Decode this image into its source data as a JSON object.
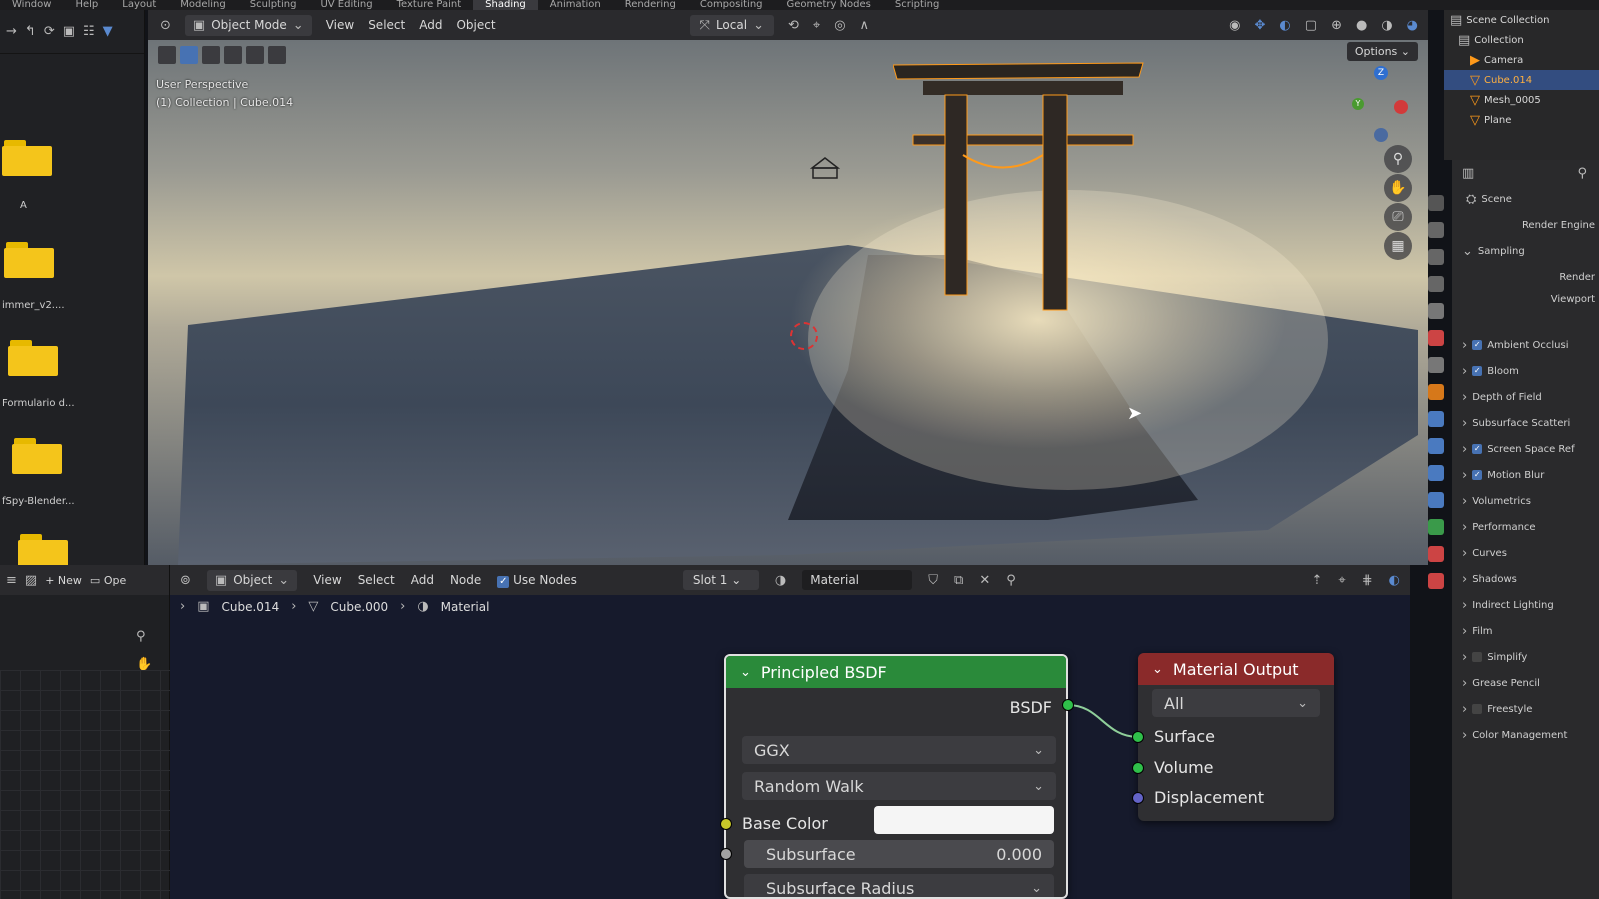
{
  "topbar": {
    "menus": [
      "Window",
      "Help"
    ],
    "workspaces": [
      "Layout",
      "Modeling",
      "Sculpting",
      "UV Editing",
      "Texture Paint",
      "Shading",
      "Animation",
      "Rendering",
      "Compositing",
      "Geometry Nodes",
      "Scripting"
    ],
    "active_workspace": "Shading"
  },
  "file_browser": {
    "items": [
      {
        "label": "A"
      },
      {
        "label": "immer_v2...."
      },
      {
        "label": "Formulario d..."
      },
      {
        "label": "fSpy-Blender..."
      },
      {
        "label": ""
      }
    ]
  },
  "viewport_header": {
    "mode": "Object Mode",
    "menus": [
      "View",
      "Select",
      "Add",
      "Object"
    ],
    "orientation": "Local"
  },
  "viewport": {
    "perspective_label": "User Perspective",
    "collection_label": "(1) Collection | Cube.014",
    "options_label": "Options",
    "gizmo_axes": {
      "z": "Z",
      "y": "Y"
    }
  },
  "node_header": {
    "object_selector": "Object",
    "menus": [
      "View",
      "Select",
      "Add",
      "Node"
    ],
    "use_nodes_label": "Use Nodes",
    "use_nodes_checked": true,
    "slot": "Slot 1",
    "material_name": "Material"
  },
  "left_lower": {
    "new_label": "New",
    "open_label": "Ope"
  },
  "breadcrumb": [
    "Cube.014",
    "Cube.000",
    "Material"
  ],
  "principled_bsdf": {
    "title": "Principled BSDF",
    "output_label": "BSDF",
    "distribution": "GGX",
    "subsurface_method": "Random Walk",
    "base_color_label": "Base Color",
    "subsurface_label": "Subsurface",
    "subsurface_value": "0.000",
    "subsurface_radius_label": "Subsurface Radius",
    "header_color": "#2a8a3a"
  },
  "material_output": {
    "title": "Material Output",
    "target": "All",
    "inputs": [
      "Surface",
      "Volume",
      "Displacement"
    ],
    "header_color": "#8a2a2a"
  },
  "outliner": {
    "items": [
      "Scene Collection",
      "Collection",
      "Camera",
      "Cube.014",
      "Mesh_0005",
      "Plane"
    ]
  },
  "properties": {
    "scene_label": "Scene",
    "render_engine_label": "Render Engine",
    "sampling_label": "Sampling",
    "render_label": "Render",
    "viewport_label": "Viewport",
    "panels": [
      {
        "label": "Ambient Occlusi",
        "checked": true
      },
      {
        "label": "Bloom",
        "checked": true
      },
      {
        "label": "Depth of Field",
        "checked": null
      },
      {
        "label": "Subsurface Scatteri",
        "checked": null
      },
      {
        "label": "Screen Space Ref",
        "checked": true
      },
      {
        "label": "Motion Blur",
        "checked": true
      },
      {
        "label": "Volumetrics",
        "checked": null
      },
      {
        "label": "Performance",
        "checked": null
      },
      {
        "label": "Curves",
        "checked": null
      },
      {
        "label": "Shadows",
        "checked": null
      },
      {
        "label": "Indirect Lighting",
        "checked": null
      },
      {
        "label": "Film",
        "checked": null
      },
      {
        "label": "Simplify",
        "checked": false
      },
      {
        "label": "Grease Pencil",
        "checked": null
      },
      {
        "label": "Freestyle",
        "checked": false
      },
      {
        "label": "Color Management",
        "checked": null
      }
    ]
  },
  "colors": {
    "accent_blue": "#4772b3",
    "socket_yellow": "#c7c729",
    "socket_green": "#2fbf4a",
    "socket_blue": "#6363c7",
    "socket_grey": "#a1a1a1",
    "selection_orange": "#ff9a1a",
    "folder_yellow": "#f4c51b"
  }
}
